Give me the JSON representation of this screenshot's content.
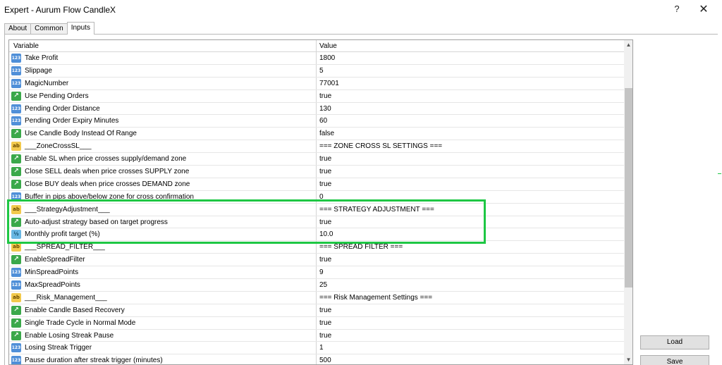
{
  "window": {
    "title": "Expert - Aurum Flow CandleX",
    "help_glyph": "?",
    "close_glyph": "✕"
  },
  "tabs": [
    {
      "label": "About"
    },
    {
      "label": "Common"
    },
    {
      "label": "Inputs"
    }
  ],
  "grid": {
    "headers": {
      "variable": "Variable",
      "value": "Value"
    },
    "rows": [
      {
        "icon": "int",
        "icon_text": "123",
        "name": "Take Profit",
        "value": "1800"
      },
      {
        "icon": "int",
        "icon_text": "123",
        "name": "Slippage",
        "value": "5"
      },
      {
        "icon": "int",
        "icon_text": "123",
        "name": "MagicNumber",
        "value": "77001"
      },
      {
        "icon": "bool",
        "icon_text": "↗",
        "name": "Use Pending Orders",
        "value": "true"
      },
      {
        "icon": "int",
        "icon_text": "123",
        "name": "Pending Order Distance",
        "value": "130"
      },
      {
        "icon": "int",
        "icon_text": "123",
        "name": "Pending Order Expiry Minutes",
        "value": "60"
      },
      {
        "icon": "bool",
        "icon_text": "↗",
        "name": "Use Candle Body Instead Of Range",
        "value": "false"
      },
      {
        "icon": "str",
        "icon_text": "ab",
        "name": "___ZoneCrossSL___",
        "value": "=== ZONE CROSS SL SETTINGS ==="
      },
      {
        "icon": "bool",
        "icon_text": "↗",
        "name": "Enable SL when price crosses supply/demand zone",
        "value": "true"
      },
      {
        "icon": "bool",
        "icon_text": "↗",
        "name": "Close SELL deals when price crosses SUPPLY zone",
        "value": "true"
      },
      {
        "icon": "bool",
        "icon_text": "↗",
        "name": "Close BUY deals when price crosses DEMAND zone",
        "value": "true"
      },
      {
        "icon": "int",
        "icon_text": "123",
        "name": "Buffer in pips above/below zone for cross confirmation",
        "value": "0"
      },
      {
        "icon": "str",
        "icon_text": "ab",
        "name": "___StrategyAdjustment___",
        "value": "=== STRATEGY ADJUSTMENT ==="
      },
      {
        "icon": "bool",
        "icon_text": "↗",
        "name": "Auto-adjust strategy based on target progress",
        "value": "true"
      },
      {
        "icon": "dbl",
        "icon_text": "½",
        "name": "Monthly profit target (%)",
        "value": "10.0"
      },
      {
        "icon": "str",
        "icon_text": "ab",
        "name": "___SPREAD_FILTER___",
        "value": "=== SPREAD FILTER ==="
      },
      {
        "icon": "bool",
        "icon_text": "↗",
        "name": "EnableSpreadFilter",
        "value": "true"
      },
      {
        "icon": "int",
        "icon_text": "123",
        "name": "MinSpreadPoints",
        "value": "9"
      },
      {
        "icon": "int",
        "icon_text": "123",
        "name": "MaxSpreadPoints",
        "value": "25"
      },
      {
        "icon": "str",
        "icon_text": "ab",
        "name": "___Risk_Management___",
        "value": "=== Risk Management Settings ==="
      },
      {
        "icon": "bool",
        "icon_text": "↗",
        "name": "Enable Candle Based Recovery",
        "value": "true"
      },
      {
        "icon": "bool",
        "icon_text": "↗",
        "name": "Single Trade Cycle in Normal Mode",
        "value": "true"
      },
      {
        "icon": "bool",
        "icon_text": "↗",
        "name": "Enable Losing Streak Pause",
        "value": "true"
      },
      {
        "icon": "int",
        "icon_text": "123",
        "name": "Losing Streak Trigger",
        "value": "1"
      },
      {
        "icon": "int",
        "icon_text": "123",
        "name": "Pause duration after streak trigger (minutes)",
        "value": "500"
      }
    ]
  },
  "buttons": {
    "load": "Load",
    "save": "Save"
  },
  "colors": {
    "highlight": "#1ec744",
    "int_icon": "#4f8fd8",
    "bool_icon": "#3aa84a",
    "string_icon": "#f2c94c",
    "double_icon": "#69b7e3"
  }
}
